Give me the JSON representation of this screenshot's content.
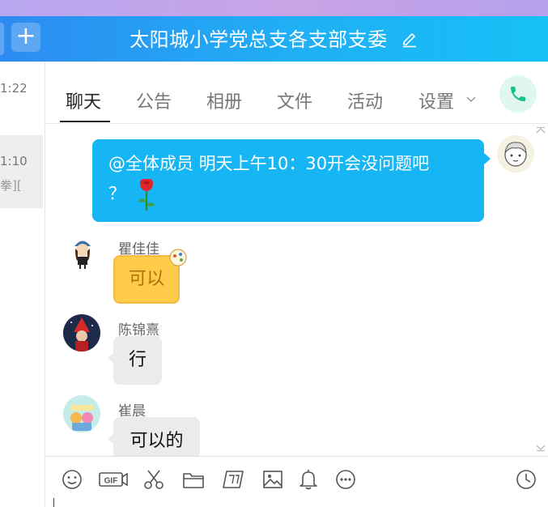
{
  "header": {
    "title": "太阳城小学党总支各支部支委",
    "add_label": "+"
  },
  "sessions": [
    {
      "time": "1:22",
      "preview": ""
    },
    {
      "time": "1:10",
      "preview": "拳]["
    }
  ],
  "tabs": [
    {
      "label": "聊天",
      "active": true
    },
    {
      "label": "公告"
    },
    {
      "label": "相册"
    },
    {
      "label": "文件"
    },
    {
      "label": "活动"
    },
    {
      "label": "设置"
    }
  ],
  "messages": [
    {
      "sender": "",
      "self": true,
      "text_line1": "@全体成员 明天上午10：30开会没问题吧",
      "text_line2": "？",
      "emoji": "rose"
    },
    {
      "sender": "瞿佳佳",
      "text": "可以",
      "style": "yellow"
    },
    {
      "sender": "陈锦熹",
      "text": "行"
    },
    {
      "sender": "崔晨",
      "text": "可以的"
    }
  ],
  "toolbar_icons": [
    "emoji-icon",
    "gif-icon",
    "scissors-icon",
    "folder-icon",
    "screenshot-icon",
    "image-icon",
    "bell-icon",
    "more-icon",
    "history-icon"
  ],
  "colors": {
    "header_start": "#2d8bf1",
    "header_end": "#17c0f6",
    "self_bubble": "#16b5f3",
    "call_icon": "#19c08a"
  }
}
